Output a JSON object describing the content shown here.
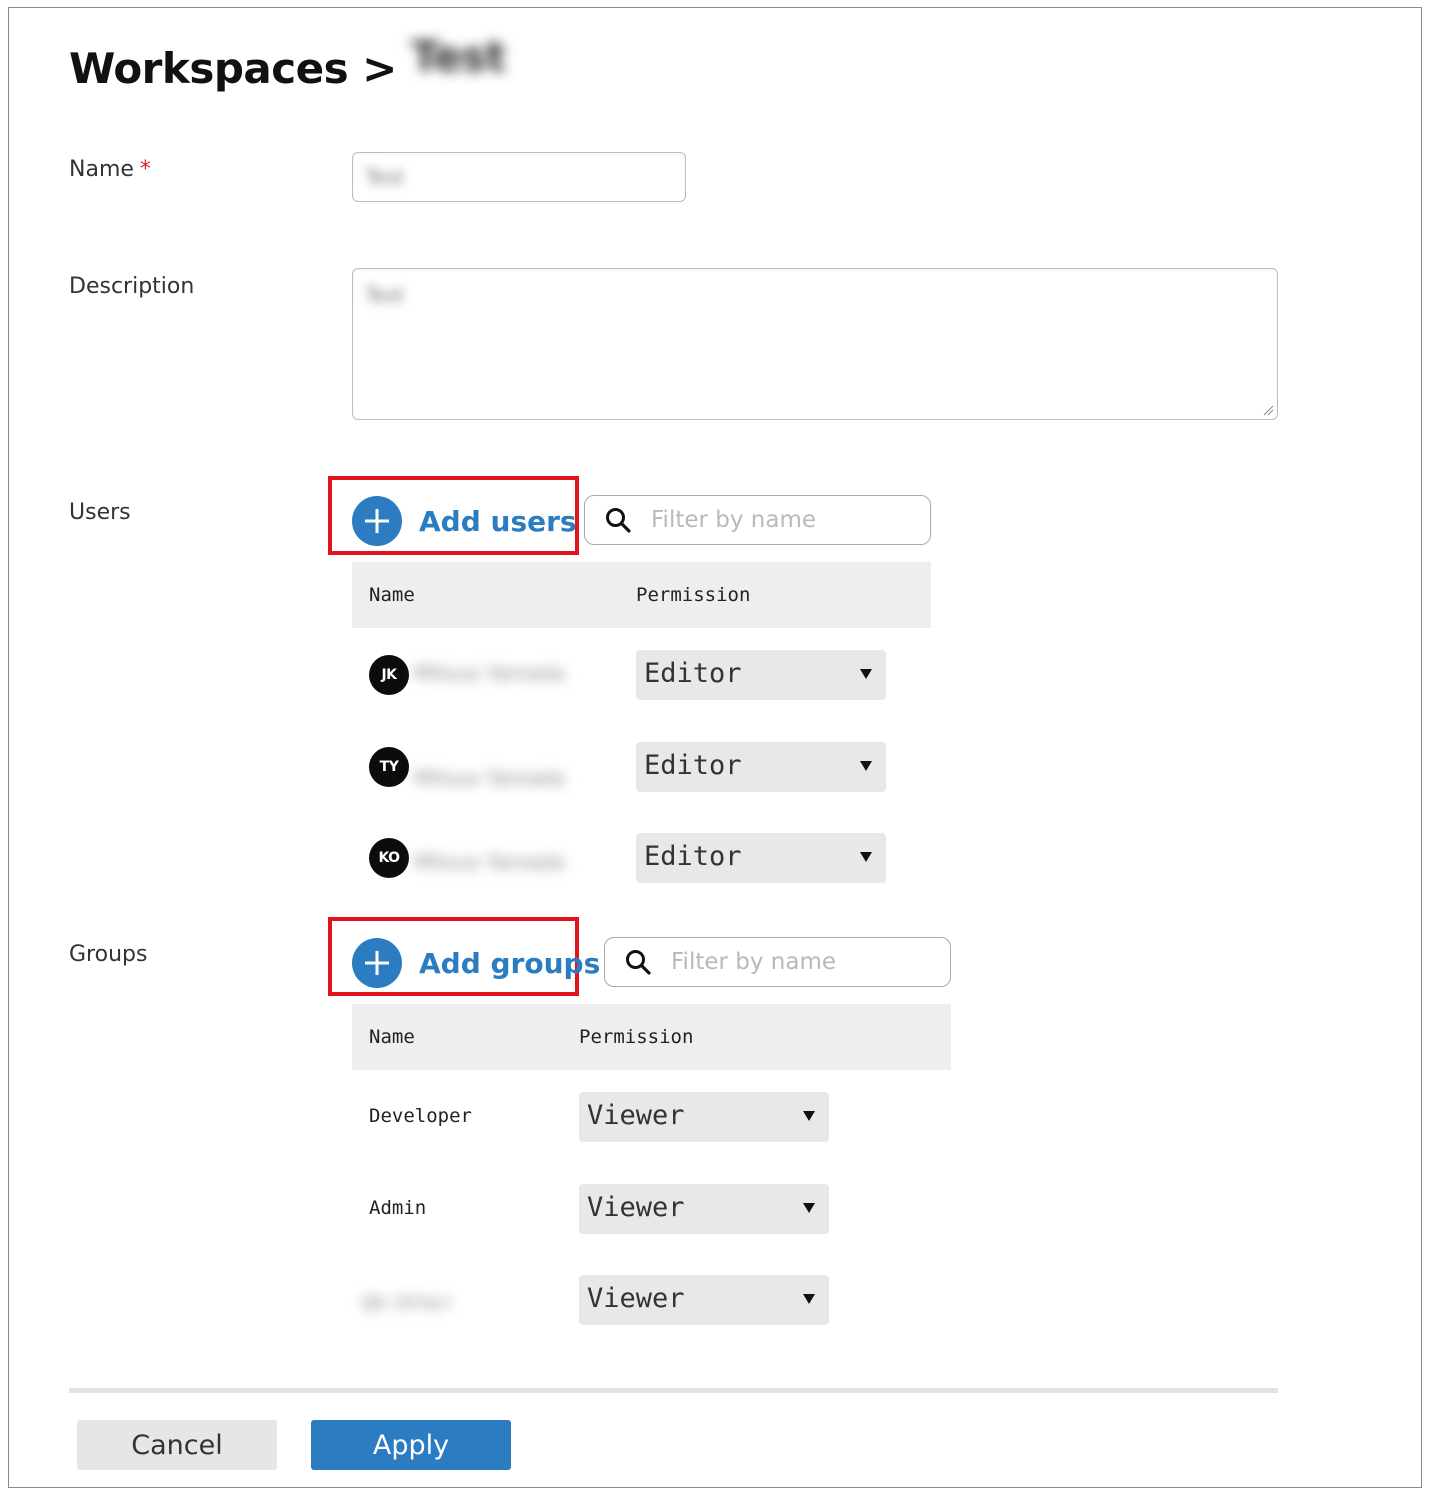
{
  "header": {
    "breadcrumb_root": "Workspaces",
    "separator": ">",
    "current": "Test"
  },
  "form": {
    "name_label": "Name",
    "required_marker": "*",
    "name_value": "Test",
    "description_label": "Description",
    "description_value": "Test"
  },
  "users": {
    "label": "Users",
    "add_label": "Add users",
    "filter_placeholder": "Filter by name",
    "columns": {
      "name": "Name",
      "permission": "Permission"
    },
    "rows": [
      {
        "initials": "JK",
        "name": "Mitsuo Yamada",
        "permission": "Editor"
      },
      {
        "initials": "TY",
        "name": "Mitsuo Yamada",
        "permission": "Editor"
      },
      {
        "initials": "KO",
        "name": "Mitsuo Yamada",
        "permission": "Editor"
      }
    ]
  },
  "groups": {
    "label": "Groups",
    "add_label": "Add groups",
    "filter_placeholder": "Filter by name",
    "columns": {
      "name": "Name",
      "permission": "Permission"
    },
    "rows": [
      {
        "name": "Developer",
        "permission": "Viewer"
      },
      {
        "name": "Admin",
        "permission": "Viewer"
      },
      {
        "name": "QA-Other",
        "permission": "Viewer"
      }
    ]
  },
  "actions": {
    "cancel_label": "Cancel",
    "apply_label": "Apply"
  },
  "colors": {
    "accent": "#2b7cc1",
    "highlight": "#e1141e",
    "required": "#d62828"
  }
}
